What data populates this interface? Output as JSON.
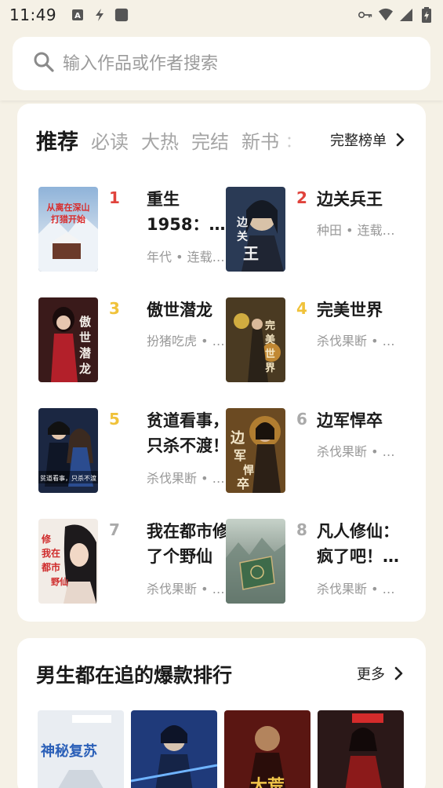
{
  "status_bar": {
    "time": "11:49",
    "left_icons": [
      "text-a-icon",
      "flash-icon",
      "square-icon"
    ],
    "right_icons": [
      "key-icon",
      "wifi-icon",
      "signal-icon",
      "battery-icon"
    ]
  },
  "search": {
    "placeholder": "输入作品或作者搜索",
    "icon": "search-icon"
  },
  "ranking": {
    "tabs": [
      "推荐",
      "必读",
      "大热",
      "完结",
      "新书",
      "："
    ],
    "active_tab": "推荐",
    "full_list_label": "完整榜单",
    "books": [
      {
        "rank": "1",
        "title_lines": [
          "重生",
          "1958：…"
        ],
        "meta": "年代 • 连载…",
        "cover_text": "从离在深山\n打猎开始"
      },
      {
        "rank": "2",
        "title_lines": [
          "边关兵王"
        ],
        "meta": "种田 • 连载…",
        "cover_text": "边关兵王"
      },
      {
        "rank": "3",
        "title_lines": [
          "傲世潜龙"
        ],
        "meta": "扮猪吃虎 • …",
        "cover_text": "傲世潜龙"
      },
      {
        "rank": "4",
        "title_lines": [
          "完美世界"
        ],
        "meta": "杀伐果断 • …",
        "cover_text": "完美世界"
      },
      {
        "rank": "5",
        "title_lines": [
          "贫道看事，",
          "只杀不渡！"
        ],
        "meta": "杀伐果断 • …",
        "cover_text": "贫道看事，只杀不渡"
      },
      {
        "rank": "6",
        "title_lines": [
          "边军悍卒"
        ],
        "meta": "杀伐果断 • …",
        "cover_text": "边军悍卒"
      },
      {
        "rank": "7",
        "title_lines": [
          "我在都市修",
          "了个野仙"
        ],
        "meta": "杀伐果断 • …",
        "cover_text": "我在都市修了个野仙"
      },
      {
        "rank": "8",
        "title_lines": [
          "凡人修仙：",
          "疯了吧！…"
        ],
        "meta": "杀伐果断 • …",
        "cover_text": ""
      }
    ],
    "rank_colors": {
      "1": "#e0433c",
      "2": "#e0433c",
      "3": "#f0c23a",
      "4": "#f0c23a",
      "5": "#f0c23a",
      "6": "#aaaaaa",
      "7": "#aaaaaa",
      "8": "#aaaaaa"
    }
  },
  "section2": {
    "title": "男生都在追的爆款排行",
    "more_label": "更多",
    "covers": [
      "神秘复苏",
      "",
      "",
      ""
    ]
  }
}
